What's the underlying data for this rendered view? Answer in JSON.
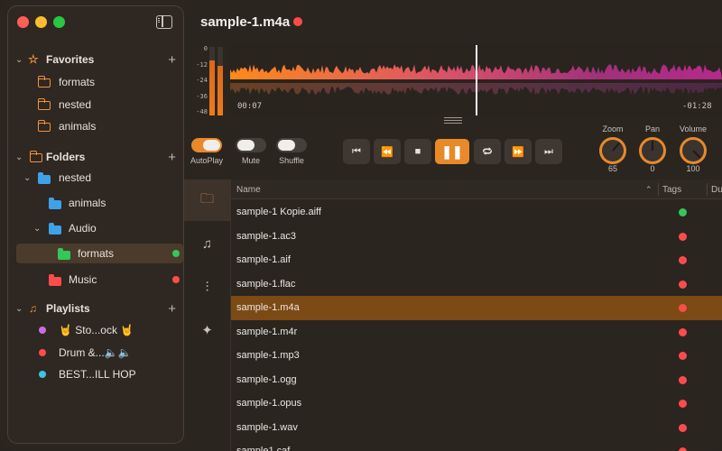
{
  "window": {
    "title": "sample-1.m4a"
  },
  "sidebar": {
    "favorites": {
      "label": "Favorites",
      "items": [
        {
          "label": "formats"
        },
        {
          "label": "nested"
        },
        {
          "label": "animals"
        }
      ]
    },
    "folders": {
      "label": "Folders",
      "items": [
        {
          "label": "nested"
        },
        {
          "label": "animals"
        },
        {
          "label": "Audio"
        },
        {
          "label": "formats"
        },
        {
          "label": "Music"
        }
      ]
    },
    "playlists": {
      "label": "Playlists",
      "items": [
        {
          "label": "🤘 Sto...ock 🤘",
          "color": "#c86ee0"
        },
        {
          "label": "Drum &...🔈🔈",
          "color": "#ff4b4b"
        },
        {
          "label": "BEST...ILL HOP",
          "color": "#3cc6e0"
        }
      ]
    }
  },
  "meter": {
    "scale": [
      "0",
      "-12",
      "-24",
      "-36",
      "-48"
    ],
    "left_level": 0.8,
    "right_level": 0.72
  },
  "waveform": {
    "elapsed": "00:07",
    "remaining": "-01:28",
    "position": 0.5
  },
  "toggles": [
    {
      "label": "AutoPlay",
      "on": true
    },
    {
      "label": "Mute",
      "on": false
    },
    {
      "label": "Shuffle",
      "on": false
    }
  ],
  "knobs": [
    {
      "label": "Zoom",
      "value": "65"
    },
    {
      "label": "Pan",
      "value": "0"
    },
    {
      "label": "Volume",
      "value": "100"
    }
  ],
  "table": {
    "columns": {
      "name": "Name",
      "tags": "Tags",
      "duration": "Du"
    },
    "rows": [
      {
        "name": "sample-1 Kopie.aiff",
        "tag": "#34c759"
      },
      {
        "name": "sample-1.ac3",
        "tag": "#ff4b4b"
      },
      {
        "name": "sample-1.aif",
        "tag": "#ff4b4b"
      },
      {
        "name": "sample-1.flac",
        "tag": "#ff4b4b"
      },
      {
        "name": "sample-1.m4a",
        "tag": "#ff4b4b"
      },
      {
        "name": "sample-1.m4r",
        "tag": "#ff4b4b"
      },
      {
        "name": "sample-1.mp3",
        "tag": "#ff4b4b"
      },
      {
        "name": "sample-1.ogg",
        "tag": "#ff4b4b"
      },
      {
        "name": "sample-1.opus",
        "tag": "#ff4b4b"
      },
      {
        "name": "sample-1.wav",
        "tag": "#ff4b4b"
      },
      {
        "name": "sample1.caf",
        "tag": "#ff4b4b"
      }
    ],
    "selected_row": 4
  },
  "colors": {
    "accent": "#e8892a",
    "selection": "#7c4a14",
    "tag_red": "#ff4b4b",
    "tag_green": "#34c759"
  }
}
